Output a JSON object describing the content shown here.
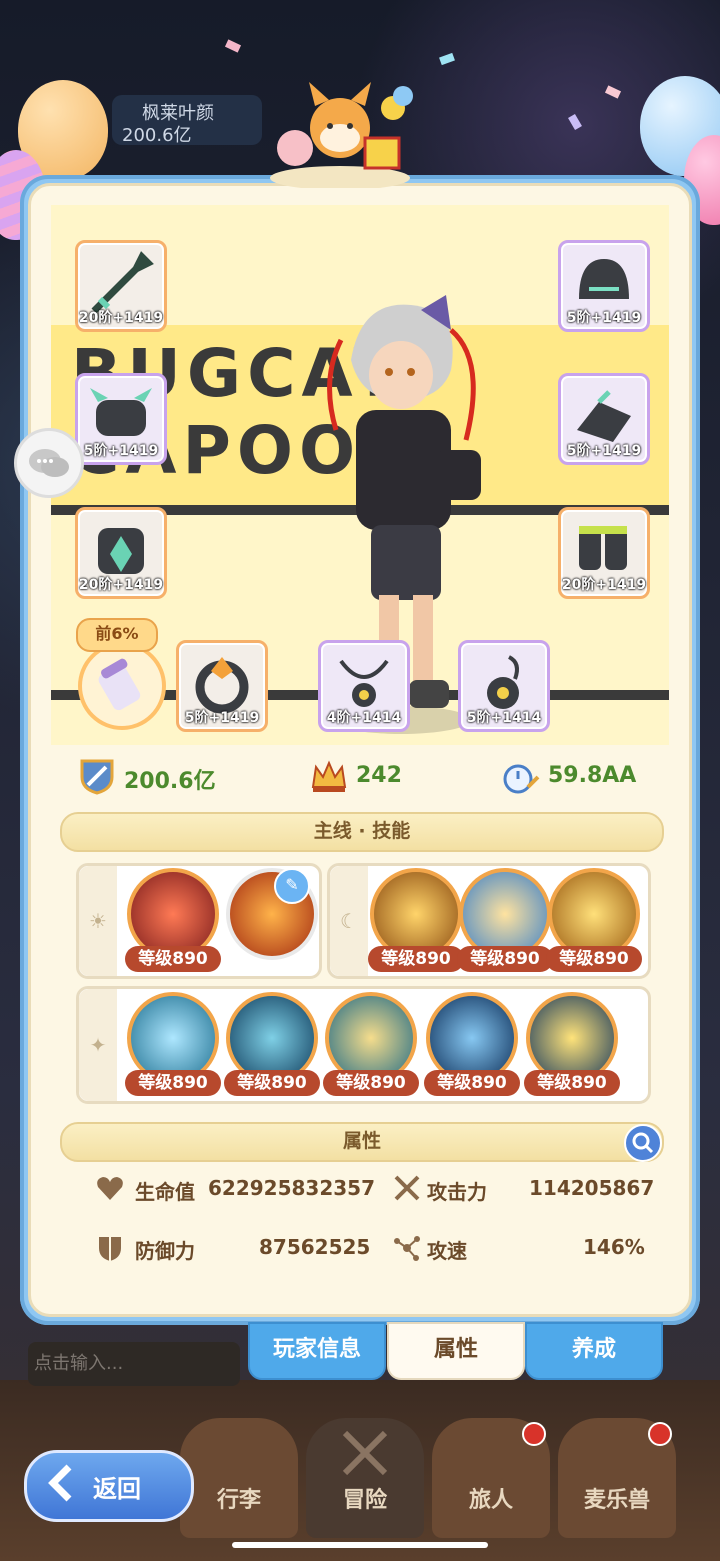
{
  "top_badge": {
    "name": "枫莱叶颜",
    "value": "200.6亿"
  },
  "banner": {
    "text": "BUGCAT CAPOO"
  },
  "equipment": [
    {
      "level": "20阶+1419",
      "icon": "sword-icon"
    },
    {
      "level": "5阶+1419",
      "icon": "helmet-icon"
    },
    {
      "level": "5阶+1419",
      "icon": "shoulder-armor-icon"
    },
    {
      "level": "5阶+1419",
      "icon": "gauntlet-icon"
    },
    {
      "level": "20阶+1419",
      "icon": "chest-armor-icon"
    },
    {
      "level": "20阶+1419",
      "icon": "boots-icon"
    },
    {
      "level": "5阶+1419",
      "icon": "ring-icon"
    },
    {
      "level": "4阶+1414",
      "icon": "necklace-icon"
    },
    {
      "level": "5阶+1414",
      "icon": "amulet-icon"
    }
  ],
  "rank_tag": "前6%",
  "stats": {
    "power": "200.6亿",
    "crown": "242",
    "speed": "59.8AA"
  },
  "skills_title": "主线 · 技能",
  "skill_groups": {
    "sun": [
      "",
      ""
    ],
    "moon": [
      "等级890",
      "等级890",
      "等级890"
    ],
    "star": [
      "等级890",
      "等级890",
      "等级890",
      "等级890",
      "等级890"
    ],
    "sun_levels": [
      "等级890"
    ]
  },
  "attributes_title": "属性",
  "attributes": {
    "hp_label": "生命值",
    "hp_value": "622925832357",
    "atk_label": "攻击力",
    "atk_value": "114205867",
    "def_label": "防御力",
    "def_value": "87562525",
    "spd_label": "攻速",
    "spd_value": "146%"
  },
  "tabs": [
    "玩家信息",
    "属性",
    "养成"
  ],
  "input_placeholder": "点击输入...",
  "nav": [
    "行李",
    "冒险",
    "旅人",
    "麦乐兽"
  ],
  "back_label": "返回",
  "colors": {
    "accent_blue": "#4fa9ea",
    "panel_cream": "#fdf7e4",
    "level_badge": "#b7492d",
    "stat_green": "#4c8a2d"
  }
}
